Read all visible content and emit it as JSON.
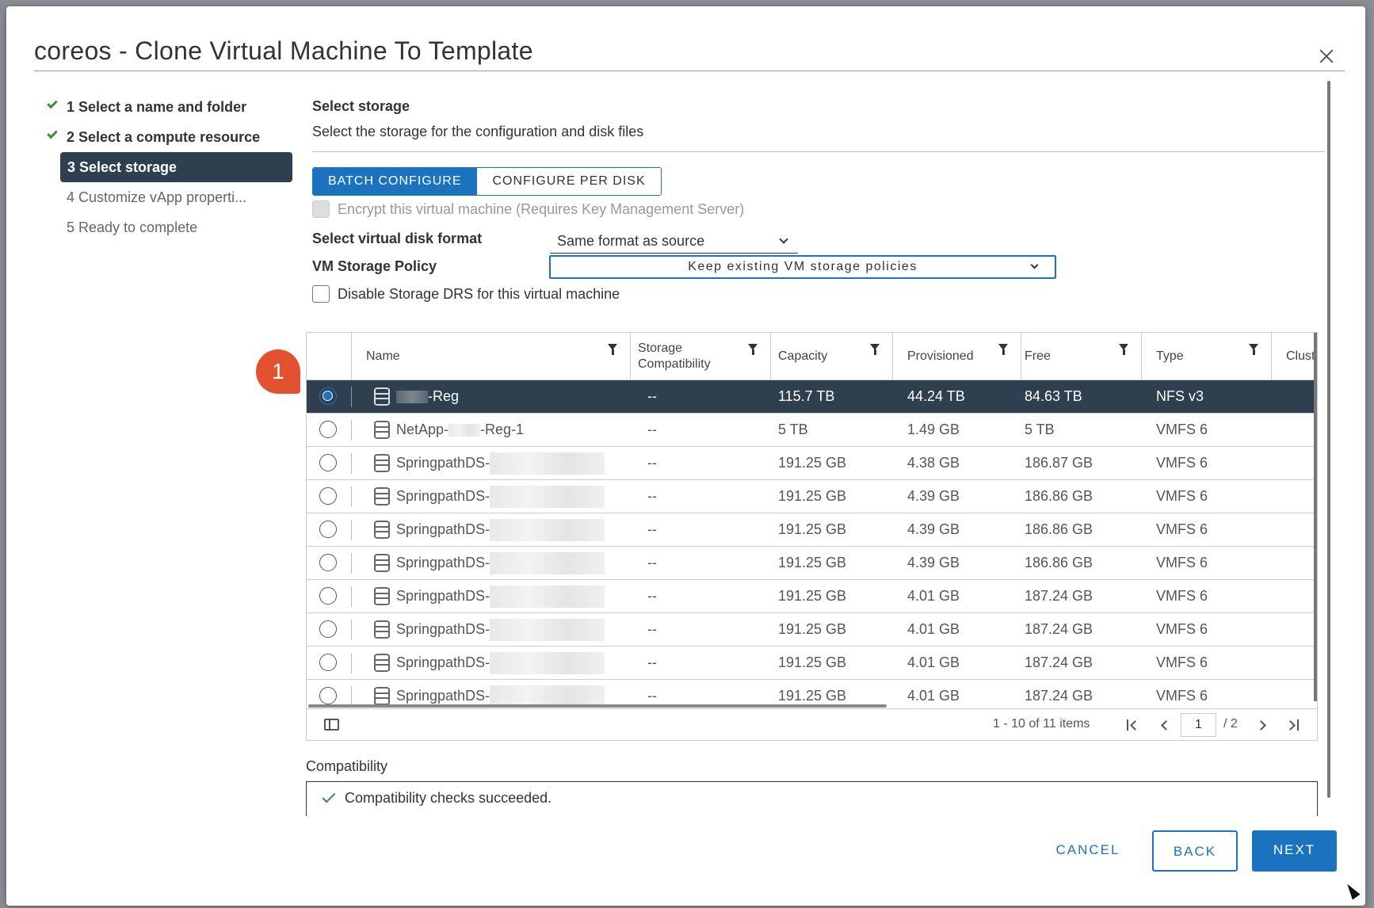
{
  "dialog": {
    "title": "coreos - Clone Virtual Machine To Template"
  },
  "steps": [
    {
      "label": "1 Select a name and folder",
      "state": "done"
    },
    {
      "label": "2 Select a compute resource",
      "state": "done"
    },
    {
      "label": "3 Select storage",
      "state": "active"
    },
    {
      "label": "4 Customize vApp properti...",
      "state": "pending"
    },
    {
      "label": "5 Ready to complete",
      "state": "pending"
    }
  ],
  "section": {
    "title": "Select storage",
    "subtitle": "Select the storage for the configuration and disk files"
  },
  "mode_toggle": {
    "batch": "BATCH CONFIGURE",
    "per_disk": "CONFIGURE PER DISK"
  },
  "options": {
    "encrypt_label": "Encrypt this virtual machine (Requires Key Management Server)",
    "disk_format_label": "Select virtual disk format",
    "disk_format_value": "Same format as source",
    "policy_label": "VM Storage Policy",
    "policy_value": "Keep existing VM storage policies",
    "drs_label": "Disable Storage DRS for this virtual machine"
  },
  "table": {
    "columns": [
      "Name",
      "Storage Compatibility",
      "Capacity",
      "Provisioned",
      "Free",
      "Type",
      "Clust"
    ],
    "rows": [
      {
        "name_prefix": "",
        "name_suffix": "-Reg",
        "compat": "--",
        "capacity": "115.7 TB",
        "provisioned": "44.24 TB",
        "free": "84.63 TB",
        "type": "NFS v3",
        "selected": true
      },
      {
        "name_prefix": "NetApp-",
        "name_suffix": "-Reg-1",
        "compat": "--",
        "capacity": "5 TB",
        "provisioned": "1.49 GB",
        "free": "5 TB",
        "type": "VMFS 6",
        "selected": false
      },
      {
        "name_prefix": "SpringpathDS-",
        "name_suffix": "",
        "compat": "--",
        "capacity": "191.25 GB",
        "provisioned": "4.38 GB",
        "free": "186.87 GB",
        "type": "VMFS 6",
        "selected": false
      },
      {
        "name_prefix": "SpringpathDS-",
        "name_suffix": "",
        "compat": "--",
        "capacity": "191.25 GB",
        "provisioned": "4.39 GB",
        "free": "186.86 GB",
        "type": "VMFS 6",
        "selected": false
      },
      {
        "name_prefix": "SpringpathDS-",
        "name_suffix": "",
        "compat": "--",
        "capacity": "191.25 GB",
        "provisioned": "4.39 GB",
        "free": "186.86 GB",
        "type": "VMFS 6",
        "selected": false
      },
      {
        "name_prefix": "SpringpathDS-",
        "name_suffix": "",
        "compat": "--",
        "capacity": "191.25 GB",
        "provisioned": "4.39 GB",
        "free": "186.86 GB",
        "type": "VMFS 6",
        "selected": false
      },
      {
        "name_prefix": "SpringpathDS-",
        "name_suffix": "",
        "compat": "--",
        "capacity": "191.25 GB",
        "provisioned": "4.01 GB",
        "free": "187.24 GB",
        "type": "VMFS 6",
        "selected": false
      },
      {
        "name_prefix": "SpringpathDS-",
        "name_suffix": "",
        "compat": "--",
        "capacity": "191.25 GB",
        "provisioned": "4.01 GB",
        "free": "187.24 GB",
        "type": "VMFS 6",
        "selected": false
      },
      {
        "name_prefix": "SpringpathDS-",
        "name_suffix": "",
        "compat": "--",
        "capacity": "191.25 GB",
        "provisioned": "4.01 GB",
        "free": "187.24 GB",
        "type": "VMFS 6",
        "selected": false
      },
      {
        "name_prefix": "SpringpathDS-",
        "name_suffix": "",
        "compat": "--",
        "capacity": "191.25 GB",
        "provisioned": "4.01 GB",
        "free": "187.24 GB",
        "type": "VMFS 6",
        "selected": false
      }
    ],
    "pagination": {
      "summary": "1 - 10 of 11 items",
      "current_page": "1",
      "total": "/ 2"
    }
  },
  "annotation_badge": "1",
  "compatibility": {
    "label": "Compatibility",
    "message": "Compatibility checks succeeded."
  },
  "footer": {
    "cancel": "CANCEL",
    "back": "BACK",
    "next": "NEXT"
  },
  "colors": {
    "primary": "#1b73c0",
    "selected_row": "#2e3f4f",
    "success": "#3d8b3a",
    "badge": "#e2522f"
  }
}
